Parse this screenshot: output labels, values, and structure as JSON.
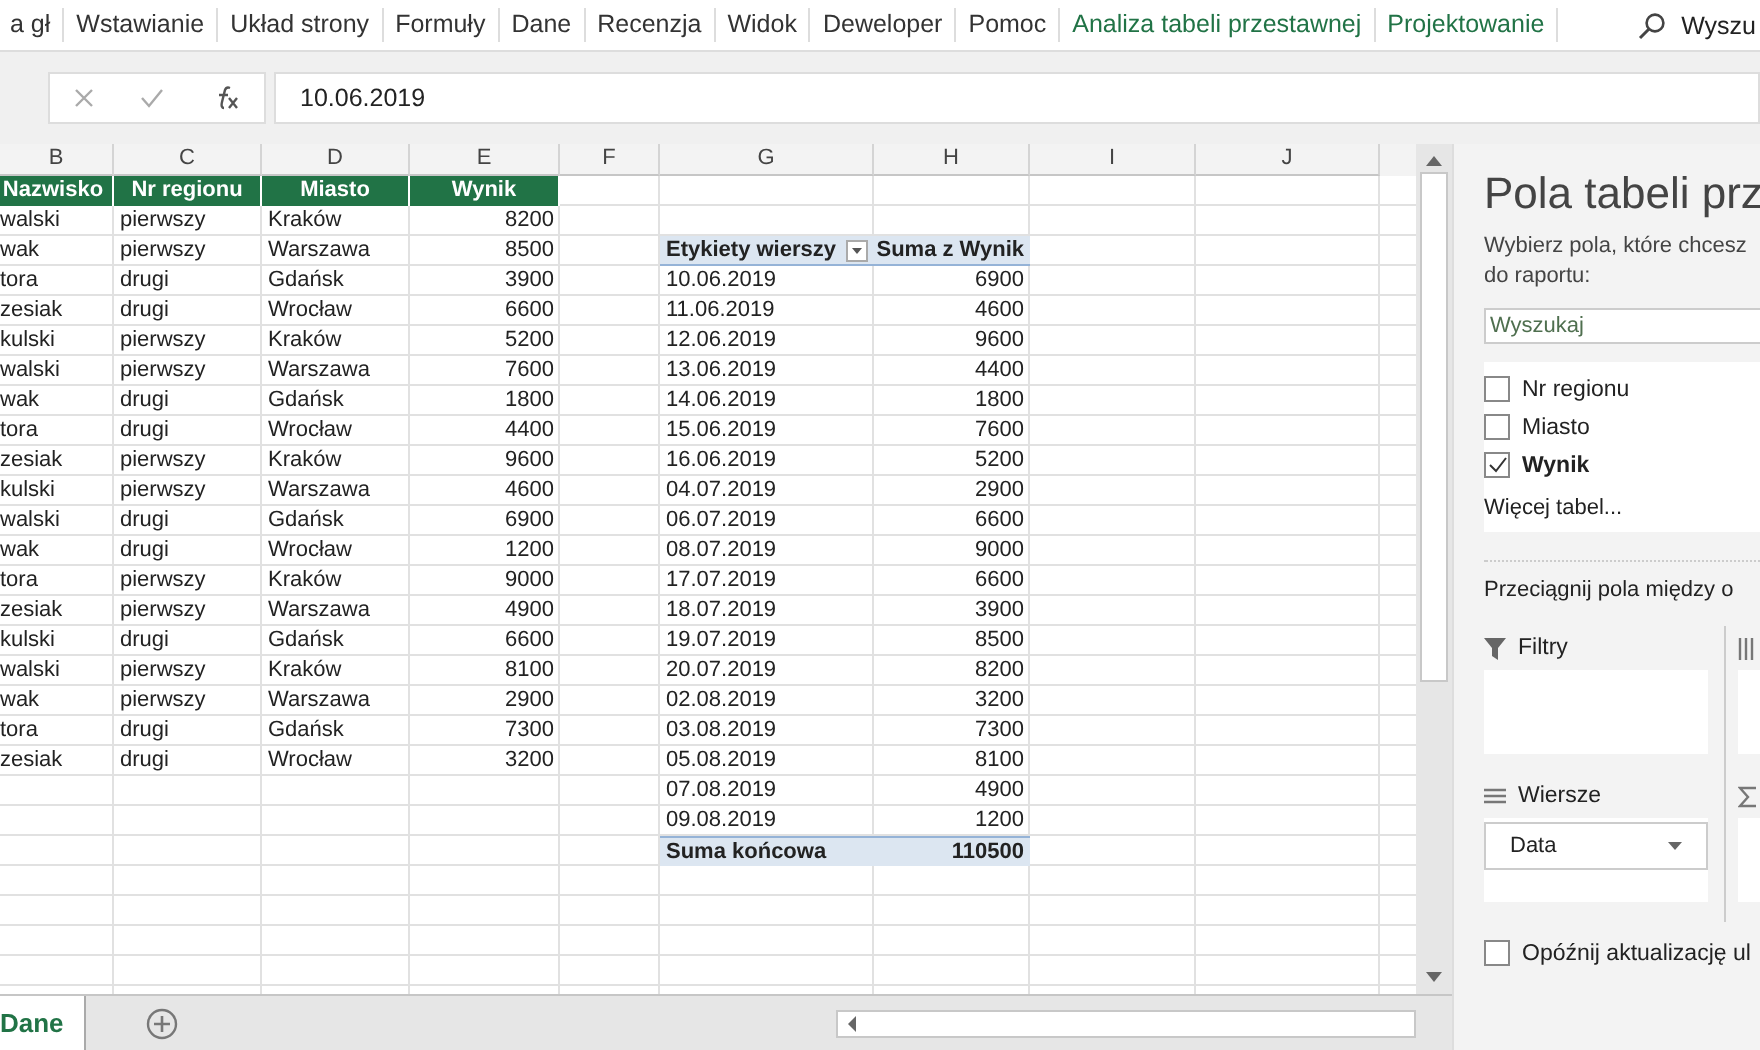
{
  "ribbon_tabs": [
    {
      "label": "a gł",
      "kind": "standard"
    },
    {
      "label": "Wstawianie",
      "kind": "standard"
    },
    {
      "label": "Układ strony",
      "kind": "standard"
    },
    {
      "label": "Formuły",
      "kind": "standard"
    },
    {
      "label": "Dane",
      "kind": "standard"
    },
    {
      "label": "Recenzja",
      "kind": "standard"
    },
    {
      "label": "Widok",
      "kind": "standard"
    },
    {
      "label": "Deweloper",
      "kind": "standard"
    },
    {
      "label": "Pomoc",
      "kind": "standard"
    },
    {
      "label": "Analiza tabeli przestawnej",
      "kind": "contextual"
    },
    {
      "label": "Projektowanie",
      "kind": "contextual"
    }
  ],
  "ribbon_search": "Wyszu",
  "formula_bar": {
    "value": "10.06.2019"
  },
  "column_headers": [
    "B",
    "C",
    "D",
    "E",
    "F",
    "G",
    "H",
    "I",
    "J"
  ],
  "data_table": {
    "columns": [
      "Nazwisko",
      "Nr regionu",
      "Miasto",
      "Wynik"
    ],
    "rows": [
      [
        "walski",
        "pierwszy",
        "Kraków",
        "8200"
      ],
      [
        "wak",
        "pierwszy",
        "Warszawa",
        "8500"
      ],
      [
        "tora",
        "drugi",
        "Gdańsk",
        "3900"
      ],
      [
        "zesiak",
        "drugi",
        "Wrocław",
        "6600"
      ],
      [
        "kulski",
        "pierwszy",
        "Kraków",
        "5200"
      ],
      [
        "walski",
        "pierwszy",
        "Warszawa",
        "7600"
      ],
      [
        "wak",
        "drugi",
        "Gdańsk",
        "1800"
      ],
      [
        "tora",
        "drugi",
        "Wrocław",
        "4400"
      ],
      [
        "zesiak",
        "pierwszy",
        "Kraków",
        "9600"
      ],
      [
        "kulski",
        "pierwszy",
        "Warszawa",
        "4600"
      ],
      [
        "walski",
        "drugi",
        "Gdańsk",
        "6900"
      ],
      [
        "wak",
        "drugi",
        "Wrocław",
        "1200"
      ],
      [
        "tora",
        "pierwszy",
        "Kraków",
        "9000"
      ],
      [
        "zesiak",
        "pierwszy",
        "Warszawa",
        "4900"
      ],
      [
        "kulski",
        "drugi",
        "Gdańsk",
        "6600"
      ],
      [
        "walski",
        "pierwszy",
        "Kraków",
        "8100"
      ],
      [
        "wak",
        "pierwszy",
        "Warszawa",
        "2900"
      ],
      [
        "tora",
        "drugi",
        "Gdańsk",
        "7300"
      ],
      [
        "zesiak",
        "drugi",
        "Wrocław",
        "3200"
      ]
    ]
  },
  "pivot_table": {
    "columns": [
      "Etykiety wierszy",
      "Suma z Wynik"
    ],
    "rows": [
      [
        "10.06.2019",
        "6900"
      ],
      [
        "11.06.2019",
        "4600"
      ],
      [
        "12.06.2019",
        "9600"
      ],
      [
        "13.06.2019",
        "4400"
      ],
      [
        "14.06.2019",
        "1800"
      ],
      [
        "15.06.2019",
        "7600"
      ],
      [
        "16.06.2019",
        "5200"
      ],
      [
        "04.07.2019",
        "2900"
      ],
      [
        "06.07.2019",
        "6600"
      ],
      [
        "08.07.2019",
        "9000"
      ],
      [
        "17.07.2019",
        "6600"
      ],
      [
        "18.07.2019",
        "3900"
      ],
      [
        "19.07.2019",
        "8500"
      ],
      [
        "20.07.2019",
        "8200"
      ],
      [
        "02.08.2019",
        "3200"
      ],
      [
        "03.08.2019",
        "7300"
      ],
      [
        "05.08.2019",
        "8100"
      ],
      [
        "07.08.2019",
        "4900"
      ],
      [
        "09.08.2019",
        "1200"
      ]
    ],
    "total": [
      "Suma końcowa",
      "110500"
    ]
  },
  "field_pane": {
    "title": "Pola tabeli prz",
    "instruction": "Wybierz pola, które chcesz\ndo raportu:",
    "search": {
      "placeholder": "Wyszukaj"
    },
    "fields": [
      {
        "label": "Nr regionu",
        "checked": false
      },
      {
        "label": "Miasto",
        "checked": false
      },
      {
        "label": "Wynik",
        "checked": true
      }
    ],
    "more_tables": "Więcej tabel...",
    "drag_hint": "Przeciągnij pola między o",
    "areas": [
      {
        "kind": "filters",
        "label": "Filtry"
      },
      {
        "kind": "columns"
      },
      {
        "kind": "rows",
        "label": "Wiersze",
        "items": [
          "Data"
        ]
      },
      {
        "kind": "values"
      }
    ],
    "defer_update": {
      "label": "Opóźnij aktualizację ul",
      "checked": false
    }
  },
  "sheet_tabs": [
    {
      "label": "Dane",
      "selected": true
    }
  ]
}
